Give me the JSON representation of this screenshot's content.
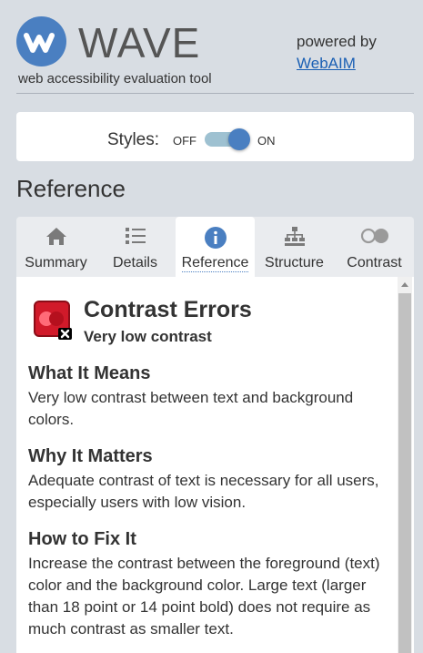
{
  "header": {
    "logo_text": "WAVE",
    "tagline": "web accessibility evaluation tool",
    "powered_by": "powered by",
    "webaim_link": "WebAIM"
  },
  "styles_toggle": {
    "label": "Styles:",
    "off_label": "OFF",
    "on_label": "ON",
    "state": "on"
  },
  "section": {
    "title": "Reference"
  },
  "tabs": [
    {
      "label": "Summary",
      "icon": "home-icon"
    },
    {
      "label": "Details",
      "icon": "list-icon"
    },
    {
      "label": "Reference",
      "icon": "info-icon",
      "active": true
    },
    {
      "label": "Structure",
      "icon": "hierarchy-icon"
    },
    {
      "label": "Contrast",
      "icon": "contrast-icon"
    }
  ],
  "reference": {
    "title": "Contrast Errors",
    "subtitle": "Very low contrast",
    "what_heading": "What It Means",
    "what_text": "Very low contrast between text and background colors.",
    "why_heading": "Why It Matters",
    "why_text": "Adequate contrast of text is necessary for all users, especially users with low vision.",
    "fix_heading": "How to Fix It",
    "fix_text": "Increase the contrast between the foreground (text) color and the background color. Large text (larger than 18 point or 14 point bold) does not require as much contrast as smaller text."
  },
  "colors": {
    "brand_blue": "#4a7fc1",
    "error_red": "#d11a2a",
    "background": "#d8dde3"
  }
}
